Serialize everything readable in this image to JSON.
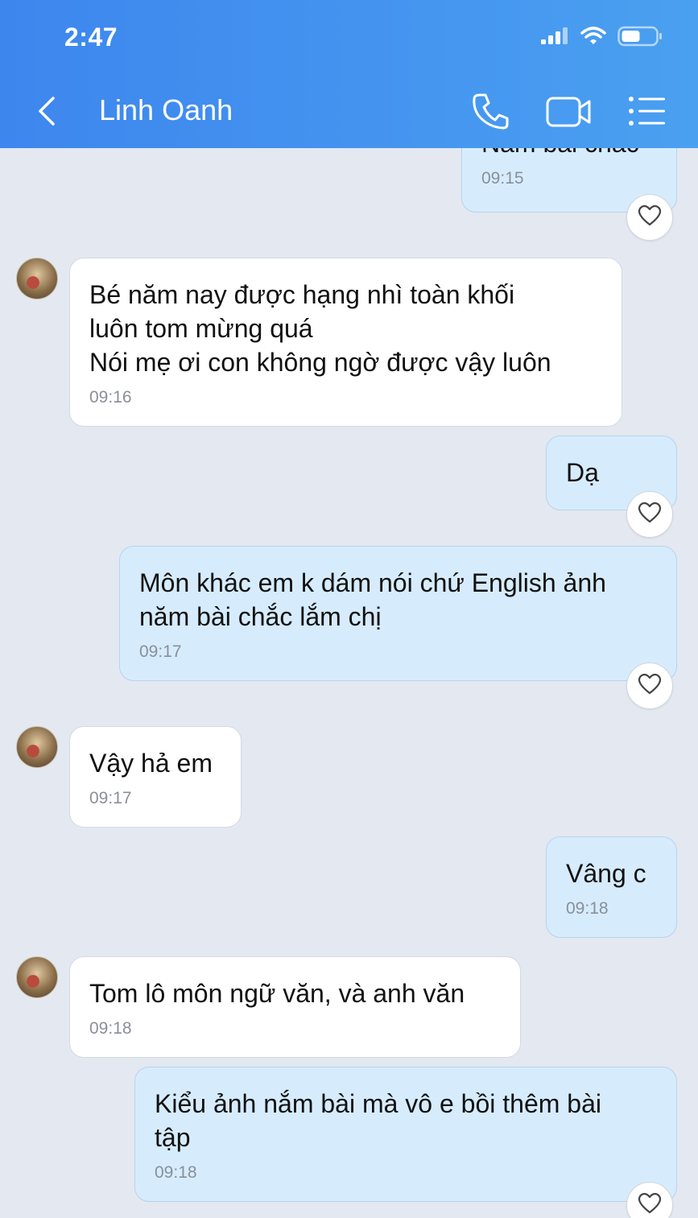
{
  "status_bar": {
    "time": "2:47"
  },
  "header": {
    "title": "Linh Oanh"
  },
  "icons": {
    "back": "chevron-left-icon",
    "call": "phone-icon",
    "video": "video-camera-icon",
    "menu": "list-menu-icon",
    "reaction": "heart-icon"
  },
  "colors": {
    "header_start": "#3d86ee",
    "header_end": "#4aa0f0",
    "chat_background": "#e4e8f0",
    "outgoing_bubble": "#d6ecfd",
    "incoming_bubble": "#ffffff"
  },
  "messages": [
    {
      "direction": "outgoing",
      "text": "Nắm bài chắc",
      "time": "09:15"
    },
    {
      "direction": "incoming",
      "text": "Bé năm nay được hạng nhì toàn khối\nluôn tom mừng quá\nNói mẹ ơi con không ngờ được vậy luôn",
      "time": "09:16"
    },
    {
      "direction": "outgoing",
      "text": "Dạ",
      "time": ""
    },
    {
      "direction": "outgoing",
      "text": "Môn khác em k dám nói chứ English ảnh\nnăm bài chắc lắm chị",
      "time": "09:17"
    },
    {
      "direction": "incoming",
      "text": "Vậy hả em",
      "time": "09:17"
    },
    {
      "direction": "outgoing",
      "text": "Vâng c",
      "time": "09:18"
    },
    {
      "direction": "incoming",
      "text": "Tom lô môn ngữ văn, và anh văn",
      "time": "09:18"
    },
    {
      "direction": "outgoing",
      "text": "Kiểu ảnh nắm bài mà vô e bồi thêm bài\ntập",
      "time": "09:18"
    }
  ]
}
